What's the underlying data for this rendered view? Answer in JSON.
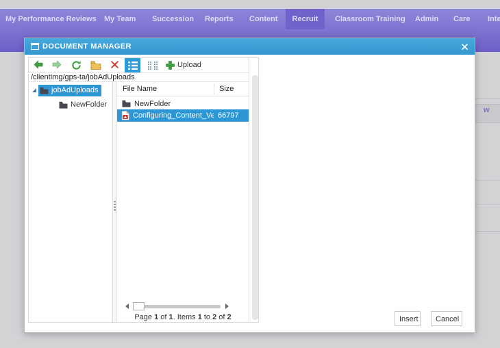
{
  "nav": {
    "items": [
      {
        "label": "My Performance Reviews"
      },
      {
        "label": "My Team"
      },
      {
        "label": "Succession"
      },
      {
        "label": "Reports"
      },
      {
        "label": "Content"
      },
      {
        "label": "Recruit",
        "active": true
      },
      {
        "label": "Classroom Training"
      },
      {
        "label": "Admin"
      },
      {
        "label": "Care"
      },
      {
        "label": "Inte"
      }
    ]
  },
  "background": {
    "partial_link_text": "w"
  },
  "dialog": {
    "title": "DOCUMENT MANAGER",
    "toolbar": {
      "upload_label": "Upload",
      "icons": [
        {
          "name": "back-icon",
          "glyph": "green-left-arrow"
        },
        {
          "name": "forward-icon",
          "glyph": "green-right-arrow"
        },
        {
          "name": "refresh-icon",
          "glyph": "green-circular-arrow"
        },
        {
          "name": "new-folder-icon",
          "glyph": "amber-folder-plus"
        },
        {
          "name": "delete-icon",
          "glyph": "red-x"
        },
        {
          "name": "list-view-icon",
          "glyph": "white-list-on-blue",
          "active": true
        },
        {
          "name": "grid-view-icon",
          "glyph": "blue-dot-grid"
        },
        {
          "name": "upload-plus-icon",
          "glyph": "green-plus"
        }
      ]
    },
    "address": "/clientimg/gps-ta/jobAdUploads",
    "tree": {
      "root_label": "jobAdUploads",
      "child_label": "NewFolder"
    },
    "list": {
      "columns": {
        "name": "File Name",
        "size": "Size"
      },
      "rows": [
        {
          "name": "NewFolder",
          "size": "",
          "type": "folder",
          "selected": false
        },
        {
          "name": "Configuring_Content_Vendo",
          "size": "66797",
          "type": "pdf",
          "selected": true
        }
      ]
    },
    "paging": {
      "parts": [
        "Page ",
        "1",
        " of ",
        "1",
        ". Items ",
        "1",
        " to ",
        "2",
        " of ",
        "2"
      ]
    },
    "buttons": {
      "insert": "Insert",
      "cancel": "Cancel"
    }
  },
  "colors": {
    "titlebar_blue": "#3b9fd5",
    "selection_blue": "#2d97d6",
    "nav_purple_top": "#8e86da",
    "nav_purple_bottom": "#6c60c7",
    "nav_active_purple": "#7063cb",
    "overlay_gray": "#d3d2d5"
  }
}
